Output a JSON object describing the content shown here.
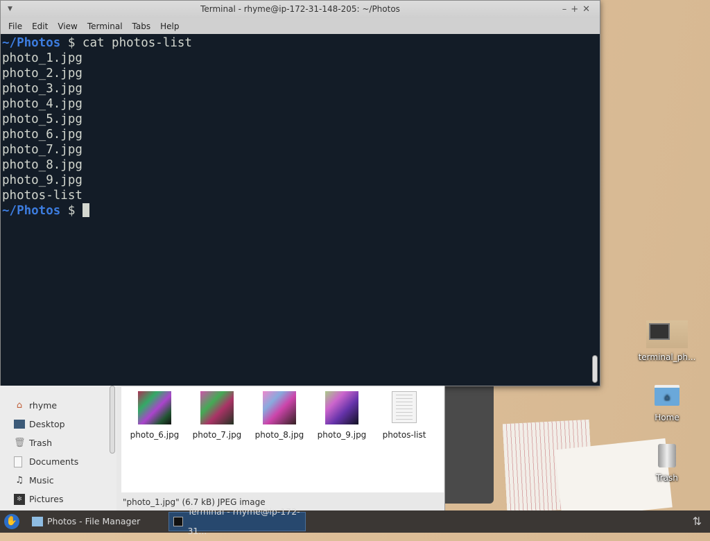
{
  "terminal": {
    "title": "Terminal - rhyme@ip-172-31-148-205: ~/Photos",
    "menu": [
      "File",
      "Edit",
      "View",
      "Terminal",
      "Tabs",
      "Help"
    ],
    "prompt": "~/Photos",
    "command": "$ cat photos-list",
    "output": [
      "photo_1.jpg",
      "photo_2.jpg",
      "photo_3.jpg",
      "photo_4.jpg",
      "photo_5.jpg",
      "photo_6.jpg",
      "photo_7.jpg",
      "photo_8.jpg",
      "photo_9.jpg",
      "photos-list"
    ],
    "prompt2": "~/Photos",
    "prompt2_symbol": "$"
  },
  "file_manager": {
    "sidebar": [
      {
        "label": "rhyme",
        "icon": "home-icon"
      },
      {
        "label": "Desktop",
        "icon": "desktop-icon"
      },
      {
        "label": "Trash",
        "icon": "trash-icon"
      },
      {
        "label": "Documents",
        "icon": "document-icon"
      },
      {
        "label": "Music",
        "icon": "music-icon"
      },
      {
        "label": "Pictures",
        "icon": "pictures-icon"
      }
    ],
    "files": [
      "photo_6.jpg",
      "photo_7.jpg",
      "photo_8.jpg",
      "photo_9.jpg",
      "photos-list"
    ],
    "status": "\"photo_1.jpg\" (6.7 kB) JPEG image"
  },
  "desktop": {
    "icons": [
      "terminal_ph...",
      "Home",
      "Trash"
    ]
  },
  "taskbar": {
    "tasks": [
      "Photos - File Manager",
      "Terminal - rhyme@ip-172-31..."
    ]
  }
}
